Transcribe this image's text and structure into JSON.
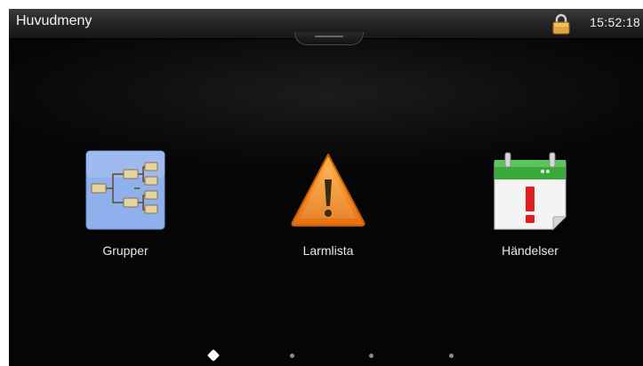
{
  "header": {
    "title": "Huvudmeny",
    "time": "15:52:18"
  },
  "icons": {
    "lock": "lock-icon",
    "pull_tab": "pull-tab"
  },
  "menu": {
    "items": [
      {
        "label": "Grupper",
        "icon": "group-tree-icon"
      },
      {
        "label": "Larmlista",
        "icon": "warning-triangle-icon"
      },
      {
        "label": "Händelser",
        "icon": "calendar-alert-icon"
      }
    ]
  },
  "pagination": {
    "pages": 4,
    "current": 1
  },
  "colors": {
    "background": "#050505",
    "titlebar": "#232323",
    "accent_warning": "#f08a1c",
    "accent_calendar": "#3aa83a",
    "group_icon_bg": "#8fb0ec"
  }
}
